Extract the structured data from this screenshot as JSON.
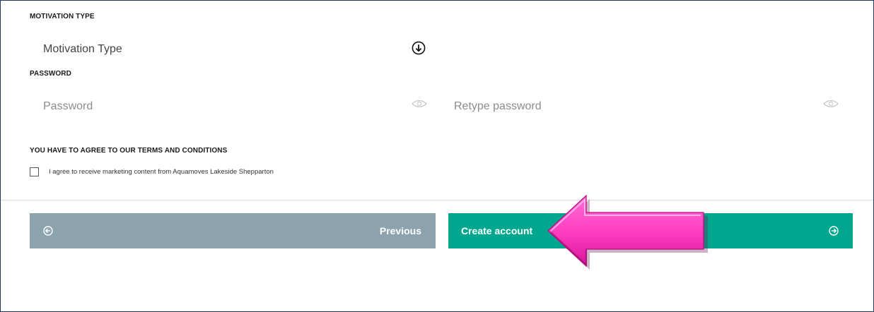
{
  "form": {
    "motivation": {
      "section_label": "MOTIVATION TYPE",
      "select_value": "Motivation Type",
      "icon": "arrow-down-circle-icon"
    },
    "password": {
      "section_label": "PASSWORD",
      "password_placeholder": "Password",
      "retype_placeholder": "Retype password",
      "icon": "eye-icon"
    },
    "terms": {
      "section_label": "YOU HAVE TO AGREE TO OUR TERMS AND CONDITIONS",
      "checkbox_label": "I agree to receive marketing content from Aquamoves Lakeside Shepparton",
      "checked": false
    }
  },
  "actions": {
    "previous_label": "Previous",
    "previous_icon": "arrow-left-circle-icon",
    "create_label": "Create account",
    "create_icon": "arrow-right-circle-icon"
  },
  "annotation": {
    "arrow_icon": "pink-arrow-left-icon",
    "arrow_color": "#ff3fc1"
  },
  "colors": {
    "previous_bg": "#8ca2ad",
    "create_bg": "#00a78e",
    "frame_border": "#1f3864"
  }
}
